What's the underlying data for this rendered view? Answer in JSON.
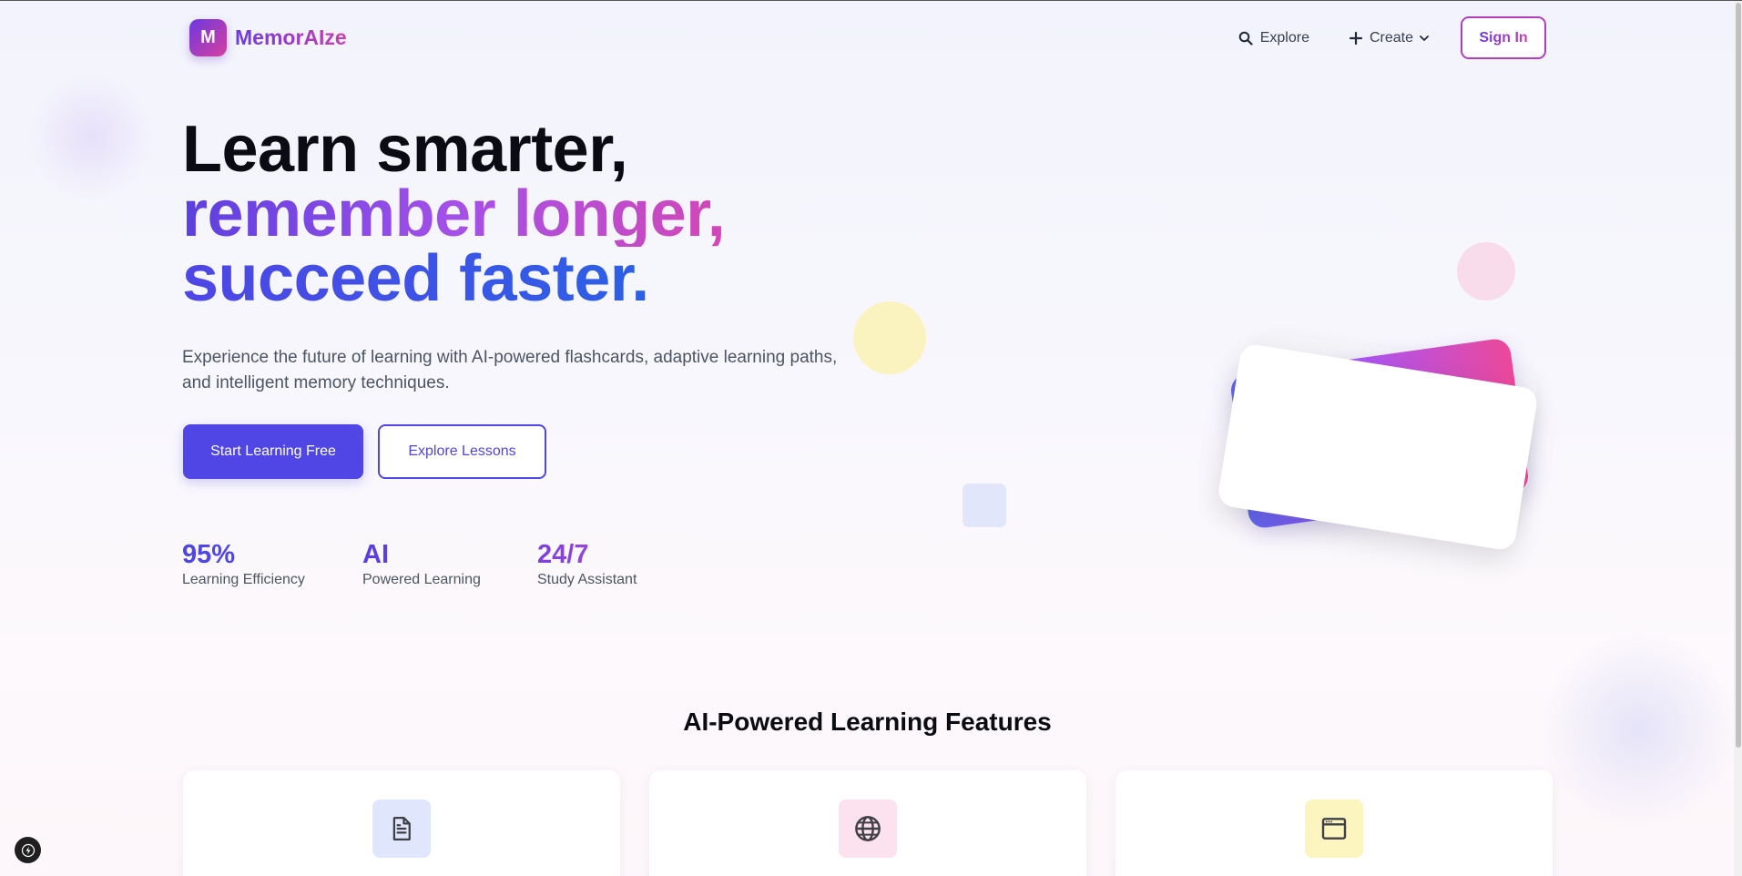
{
  "brand": {
    "logo_letter": "M",
    "name": "MemorAIze"
  },
  "nav": {
    "explore_label": "Explore",
    "create_label": "Create",
    "signin_label": "Sign In"
  },
  "hero": {
    "title_line1": "Learn smarter,",
    "title_line2": "remember longer,",
    "title_line3": "succeed faster.",
    "description": "Experience the future of learning with AI-powered flashcards, adaptive learning paths, and intelligent memory techniques.",
    "primary_button": "Start Learning Free",
    "secondary_button": "Explore Lessons"
  },
  "stats": [
    {
      "value": "95%",
      "label": "Learning Efficiency"
    },
    {
      "value": "AI",
      "label": "Powered Learning"
    },
    {
      "value": "24/7",
      "label": "Study Assistant"
    }
  ],
  "features": {
    "title": "AI-Powered Learning Features",
    "cards": [
      {
        "icon": "document-icon"
      },
      {
        "icon": "globe-icon"
      },
      {
        "icon": "browser-window-icon"
      }
    ]
  },
  "colors": {
    "primary": "#4f46e5",
    "brand_gradient_start": "#6a3ae0",
    "brand_gradient_end": "#c93fae",
    "text_dark": "#0b0b12",
    "text_muted": "#4b5563"
  }
}
